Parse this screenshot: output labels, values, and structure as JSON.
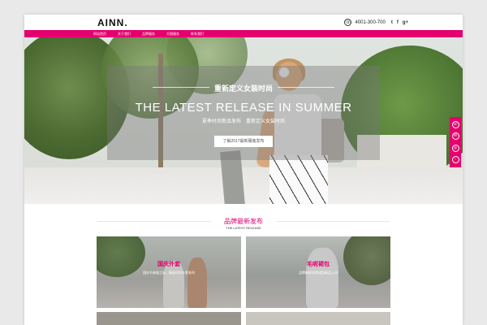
{
  "header": {
    "logo": "AINN.",
    "phone": "4001-300-700",
    "social": [
      "t",
      "f",
      "g+"
    ]
  },
  "nav": {
    "items": [
      "网站首页",
      "关于我们",
      "品牌服务",
      "大图服务",
      "联系我们"
    ]
  },
  "hero": {
    "cn_title": "重新定义女装时尚",
    "title": "THE LATEST RELEASE IN SUMMER",
    "sub_left": "夏季时尚新品发布",
    "sub_right": "重新定义女装时尚",
    "button": "了解2017最新服装发布"
  },
  "side_toolbar": {
    "icons": [
      "phone-icon",
      "chat-icon",
      "qq-icon",
      "top-icon"
    ],
    "glyphs": [
      "☏",
      "✉",
      "◎",
      "↑"
    ]
  },
  "section": {
    "title": "品牌最新发布",
    "subtitle": "THE LATEST RELEASE"
  },
  "cards": [
    {
      "title": "国庆外套",
      "desc": "国庆节来临之际，精选时尚外套系列"
    },
    {
      "title": "毛呢裙包",
      "desc": "品牌新款毛呢裙包新品上市"
    }
  ],
  "colors": {
    "accent": "#e4006e",
    "nav_text": "#ffffff"
  }
}
